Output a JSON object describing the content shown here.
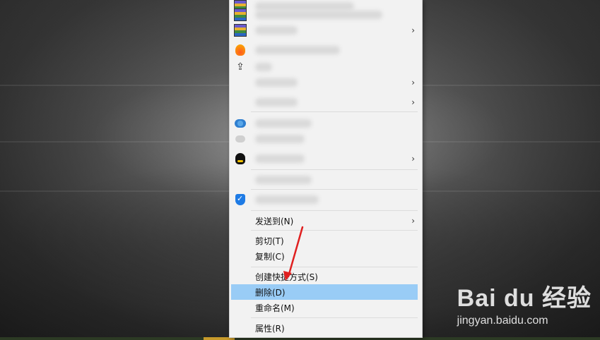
{
  "context_menu": {
    "items": [
      {
        "label": "发送到(N)",
        "has_submenu": true
      },
      {
        "label": "剪切(T)"
      },
      {
        "label": "复制(C)"
      },
      {
        "label": "创建快捷方式(S)"
      },
      {
        "label": "删除(D)",
        "highlighted": true
      },
      {
        "label": "重命名(M)"
      },
      {
        "label": "属性(R)"
      }
    ],
    "blurred_icons": [
      "winrar-icon",
      "winrar-icon",
      "winrar-icon",
      "security-fire-icon",
      "share-icon",
      "baidu-netdisk-icon",
      "cloud-icon",
      "qq-icon",
      "shield-icon"
    ]
  },
  "watermark": {
    "brand": "Bai du 经验",
    "url": "jingyan.baidu.com"
  },
  "colors": {
    "highlight": "#99ccf6",
    "menu_bg": "#f2f2f2",
    "annotation_arrow": "#e02020"
  }
}
